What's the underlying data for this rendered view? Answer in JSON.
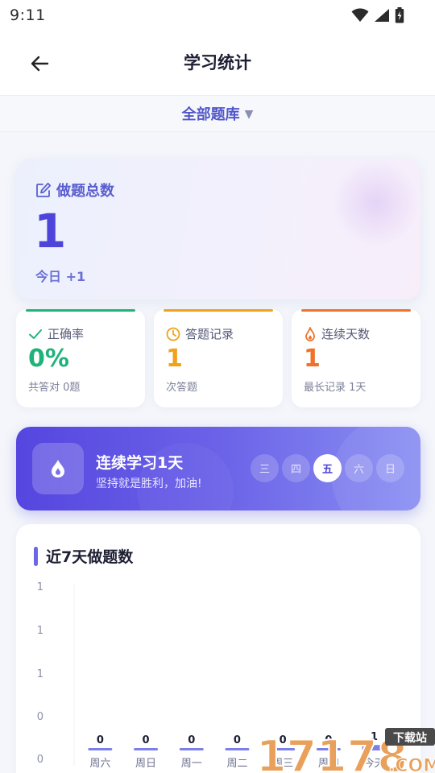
{
  "status_bar": {
    "time": "9:11",
    "icons": [
      "wifi-icon",
      "signal-icon",
      "battery-icon"
    ]
  },
  "app_bar": {
    "title": "学习统计",
    "back_icon": "arrow-left-icon"
  },
  "question_bank": {
    "label": "全部题库",
    "icon": "caret-down-icon"
  },
  "total_card": {
    "icon": "edit-icon",
    "title": "做题总数",
    "value": "1",
    "today": "今日 +1"
  },
  "stats": [
    {
      "icon": "check-icon",
      "label": "正确率",
      "value": "0%",
      "sub": "共答对 0题",
      "color": "#1fb37a"
    },
    {
      "icon": "clock-icon",
      "label": "答题记录",
      "value": "1",
      "sub": "次答题",
      "color": "#f0a21c"
    },
    {
      "icon": "flame-icon",
      "label": "连续天数",
      "value": "1",
      "sub": "最长记录 1天",
      "color": "#f0722b"
    }
  ],
  "streak": {
    "icon": "drop-icon",
    "title": "连续学习1天",
    "subtitle": "坚持就是胜利，加油!",
    "days": [
      "三",
      "四",
      "五",
      "六",
      "日"
    ],
    "active_day": "五"
  },
  "chart": {
    "title": "近7天做题数"
  },
  "chart_data": {
    "type": "bar",
    "title": "近7天做题数",
    "categories": [
      "周六",
      "周日",
      "周一",
      "周二",
      "周三",
      "周四",
      "今天"
    ],
    "values": [
      0,
      0,
      0,
      0,
      0,
      0,
      1
    ],
    "y_ticks": [
      "1",
      "1",
      "1",
      "0",
      "0"
    ],
    "ylim": [
      0,
      1
    ],
    "grid": false,
    "bar_color": "#7b7fe8"
  },
  "watermark": {
    "number": "17178",
    "suffix": ".COM",
    "tag": "下载站"
  }
}
